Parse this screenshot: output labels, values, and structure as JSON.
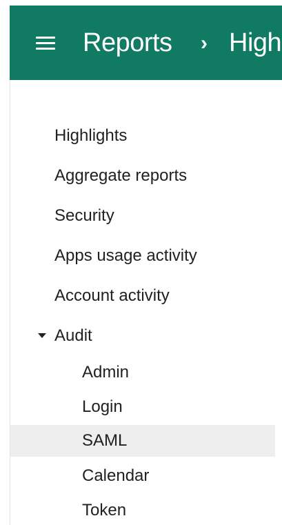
{
  "header": {
    "breadcrumb_root": "Reports",
    "breadcrumb_separator": "›",
    "breadcrumb_current": "Highlights"
  },
  "nav": {
    "items": [
      {
        "label": "Highlights"
      },
      {
        "label": "Aggregate reports"
      },
      {
        "label": "Security"
      },
      {
        "label": "Apps usage activity"
      },
      {
        "label": "Account activity"
      },
      {
        "label": "Audit",
        "expanded": true
      }
    ],
    "audit_children": [
      {
        "label": "Admin"
      },
      {
        "label": "Login"
      },
      {
        "label": "SAML",
        "selected": true
      },
      {
        "label": "Calendar"
      },
      {
        "label": "Token"
      }
    ]
  },
  "colors": {
    "header_bg": "#107a63",
    "selected_bg": "#eeeeee",
    "text": "#202124"
  },
  "icons": {
    "menu": "hamburger-menu-icon",
    "caret": "caret-down-icon"
  }
}
